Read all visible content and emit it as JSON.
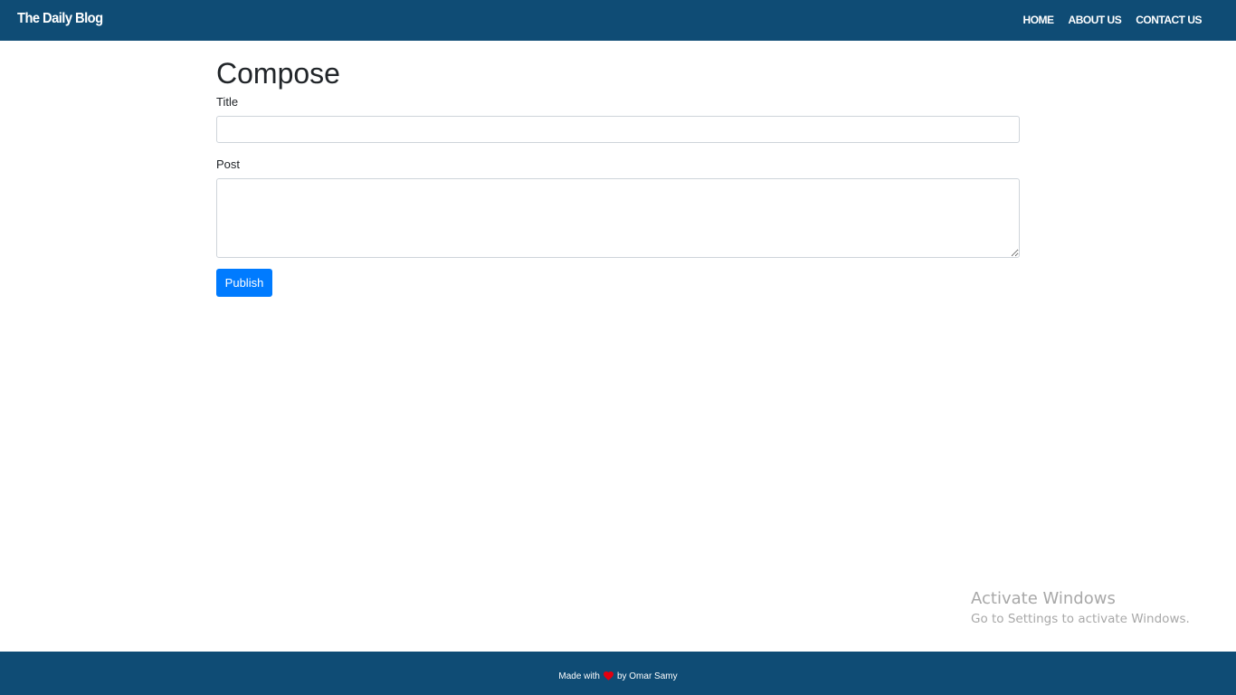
{
  "navbar": {
    "brand": "The Daily Blog",
    "links": [
      "HOME",
      "ABOUT US",
      "CONTACT US"
    ],
    "background": "#0f4c75"
  },
  "main": {
    "title": "Compose",
    "title_label": "Title",
    "title_value": "",
    "post_label": "Post",
    "post_value": "",
    "publish_label": "Publish",
    "accent": "#007bff"
  },
  "watermark": {
    "title": "Activate Windows",
    "subtitle": "Go to Settings to activate Windows."
  },
  "footer": {
    "prefix": "Made with",
    "icon": "heart-icon",
    "suffix": "by Omar Samy",
    "heart_color": "#e3000f"
  }
}
